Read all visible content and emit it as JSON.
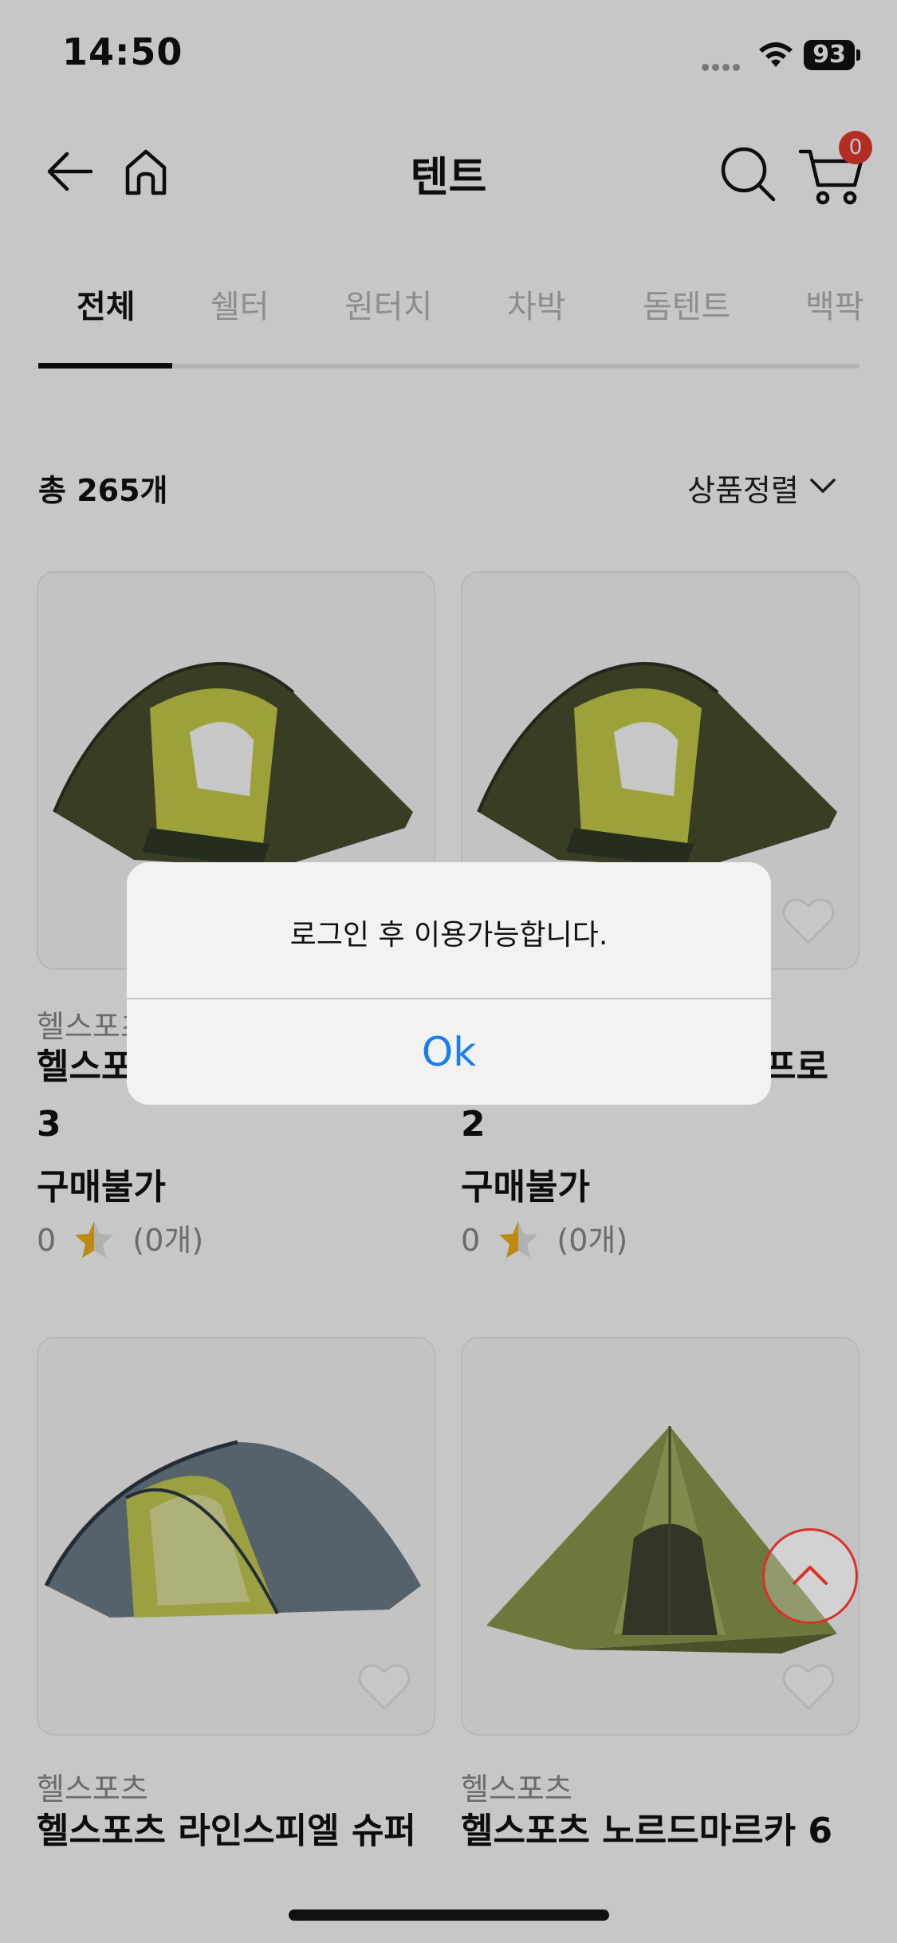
{
  "status_bar": {
    "time": "14:50",
    "battery": "93"
  },
  "header": {
    "title": "텐트",
    "cart_count": "0"
  },
  "tabs": [
    {
      "label": "전체"
    },
    {
      "label": "쉘터"
    },
    {
      "label": "원터치"
    },
    {
      "label": "차박"
    },
    {
      "label": "돔텐트"
    },
    {
      "label": "백팍"
    }
  ],
  "list": {
    "count": "총 265개",
    "sort_label": "상품정렬"
  },
  "products": [
    {
      "brand": "헬스포츠",
      "name": "헬스포",
      "name2": "3",
      "price": "구매불가",
      "rating": "0",
      "reviews": "(0개)"
    },
    {
      "brand": "",
      "name": "프로",
      "name2": "2",
      "price": "구매불가",
      "rating": "0",
      "reviews": "(0개)"
    },
    {
      "brand": "헬스포츠",
      "name": "헬스포츠 라인스피엘 슈퍼"
    },
    {
      "brand": "헬스포츠",
      "name": "헬스포츠 노르드마르카 6"
    }
  ],
  "alert": {
    "message": "로그인 후 이용가능합니다.",
    "ok_label": "Ok"
  },
  "colors": {
    "accent": "#1a7cf0",
    "badge": "#e53a2f",
    "tent_olive": "#4a4f2f",
    "tent_lime": "#c9cf4a"
  }
}
